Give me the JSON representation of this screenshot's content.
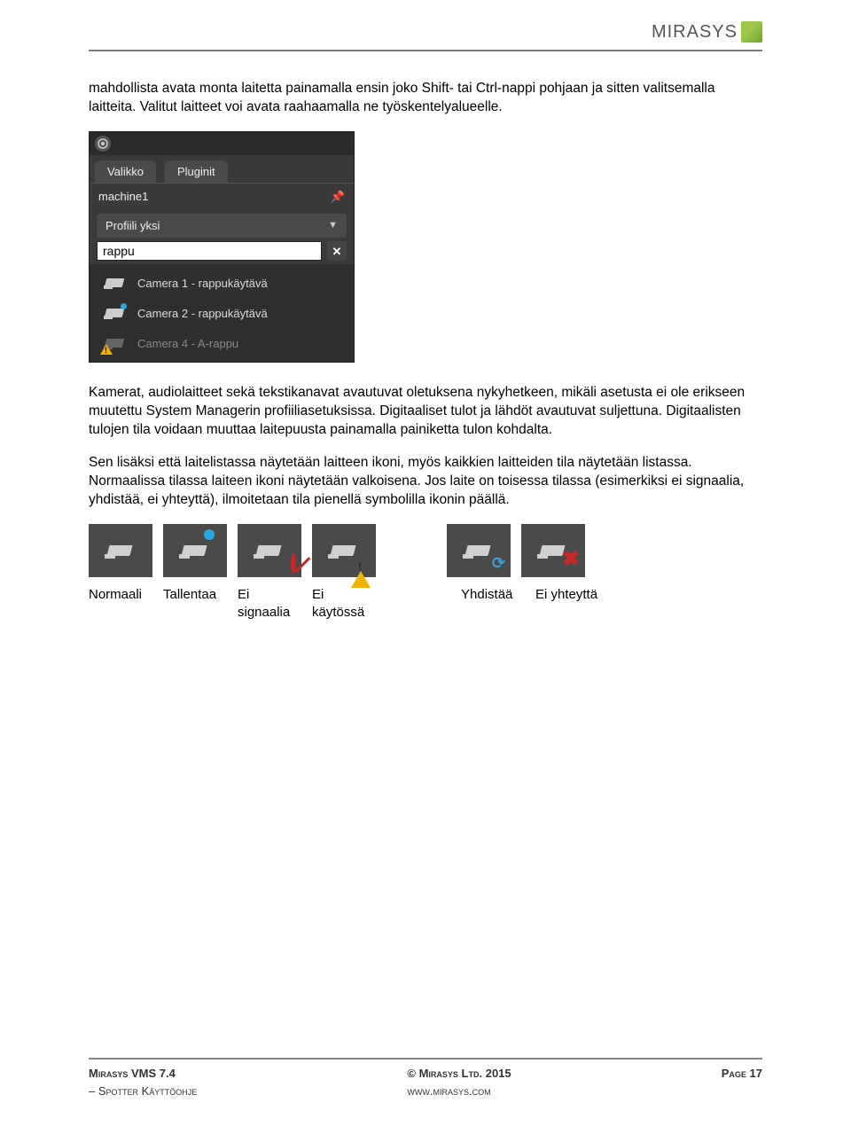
{
  "logo_text": "MIRASYS",
  "para1": "mahdollista avata monta laitetta painamalla ensin joko Shift- tai Ctrl-nappi pohjaan ja sitten valitsemalla laitteita. Valitut laitteet voi avata raahaamalla ne työskentelyalueelle.",
  "ui": {
    "tab1": "Valikko",
    "tab2": "Pluginit",
    "machine": "machine1",
    "profile": "Profiili yksi",
    "search_value": "rappu",
    "cam1": "Camera 1 - rappukäytävä",
    "cam2": "Camera 2 - rappukäytävä",
    "cam4": "Camera 4 - A-rappu"
  },
  "para2": "Kamerat, audiolaitteet sekä tekstikanavat avautuvat oletuksena nykyhetkeen, mikäli asetusta ei ole erikseen muutettu System Managerin profiiliasetuksissa. Digitaaliset tulot ja lähdöt avautuvat suljettuna. Digitaalisten tulojen tila voidaan muuttaa laitepuusta painamalla painiketta tulon kohdalta.",
  "para3": "Sen lisäksi että laitelistassa näytetään laitteen ikoni, myös kaikkien laitteiden tila näytetään listassa. Normaalissa tilassa laiteen ikoni näytetään valkoisena. Jos laite on toisessa tilassa (esimerkiksi ei signaalia, yhdistää, ei yhteyttä), ilmoitetaan tila pienellä symbolilla ikonin päällä.",
  "labels": {
    "normal": "Normaali",
    "record": "Tallentaa",
    "nosignal": "Ei signaalia",
    "disabled": "Ei käytössä",
    "connecting": "Yhdistää",
    "noconn": "Ei yhteyttä"
  },
  "footer": {
    "product": "Mirasys VMS 7.4",
    "subtitle": "– Spotter Käyttöohje",
    "copyright": "© Mirasys Ltd. 2015",
    "url": "www.mirasys.com",
    "page": "Page 17"
  }
}
